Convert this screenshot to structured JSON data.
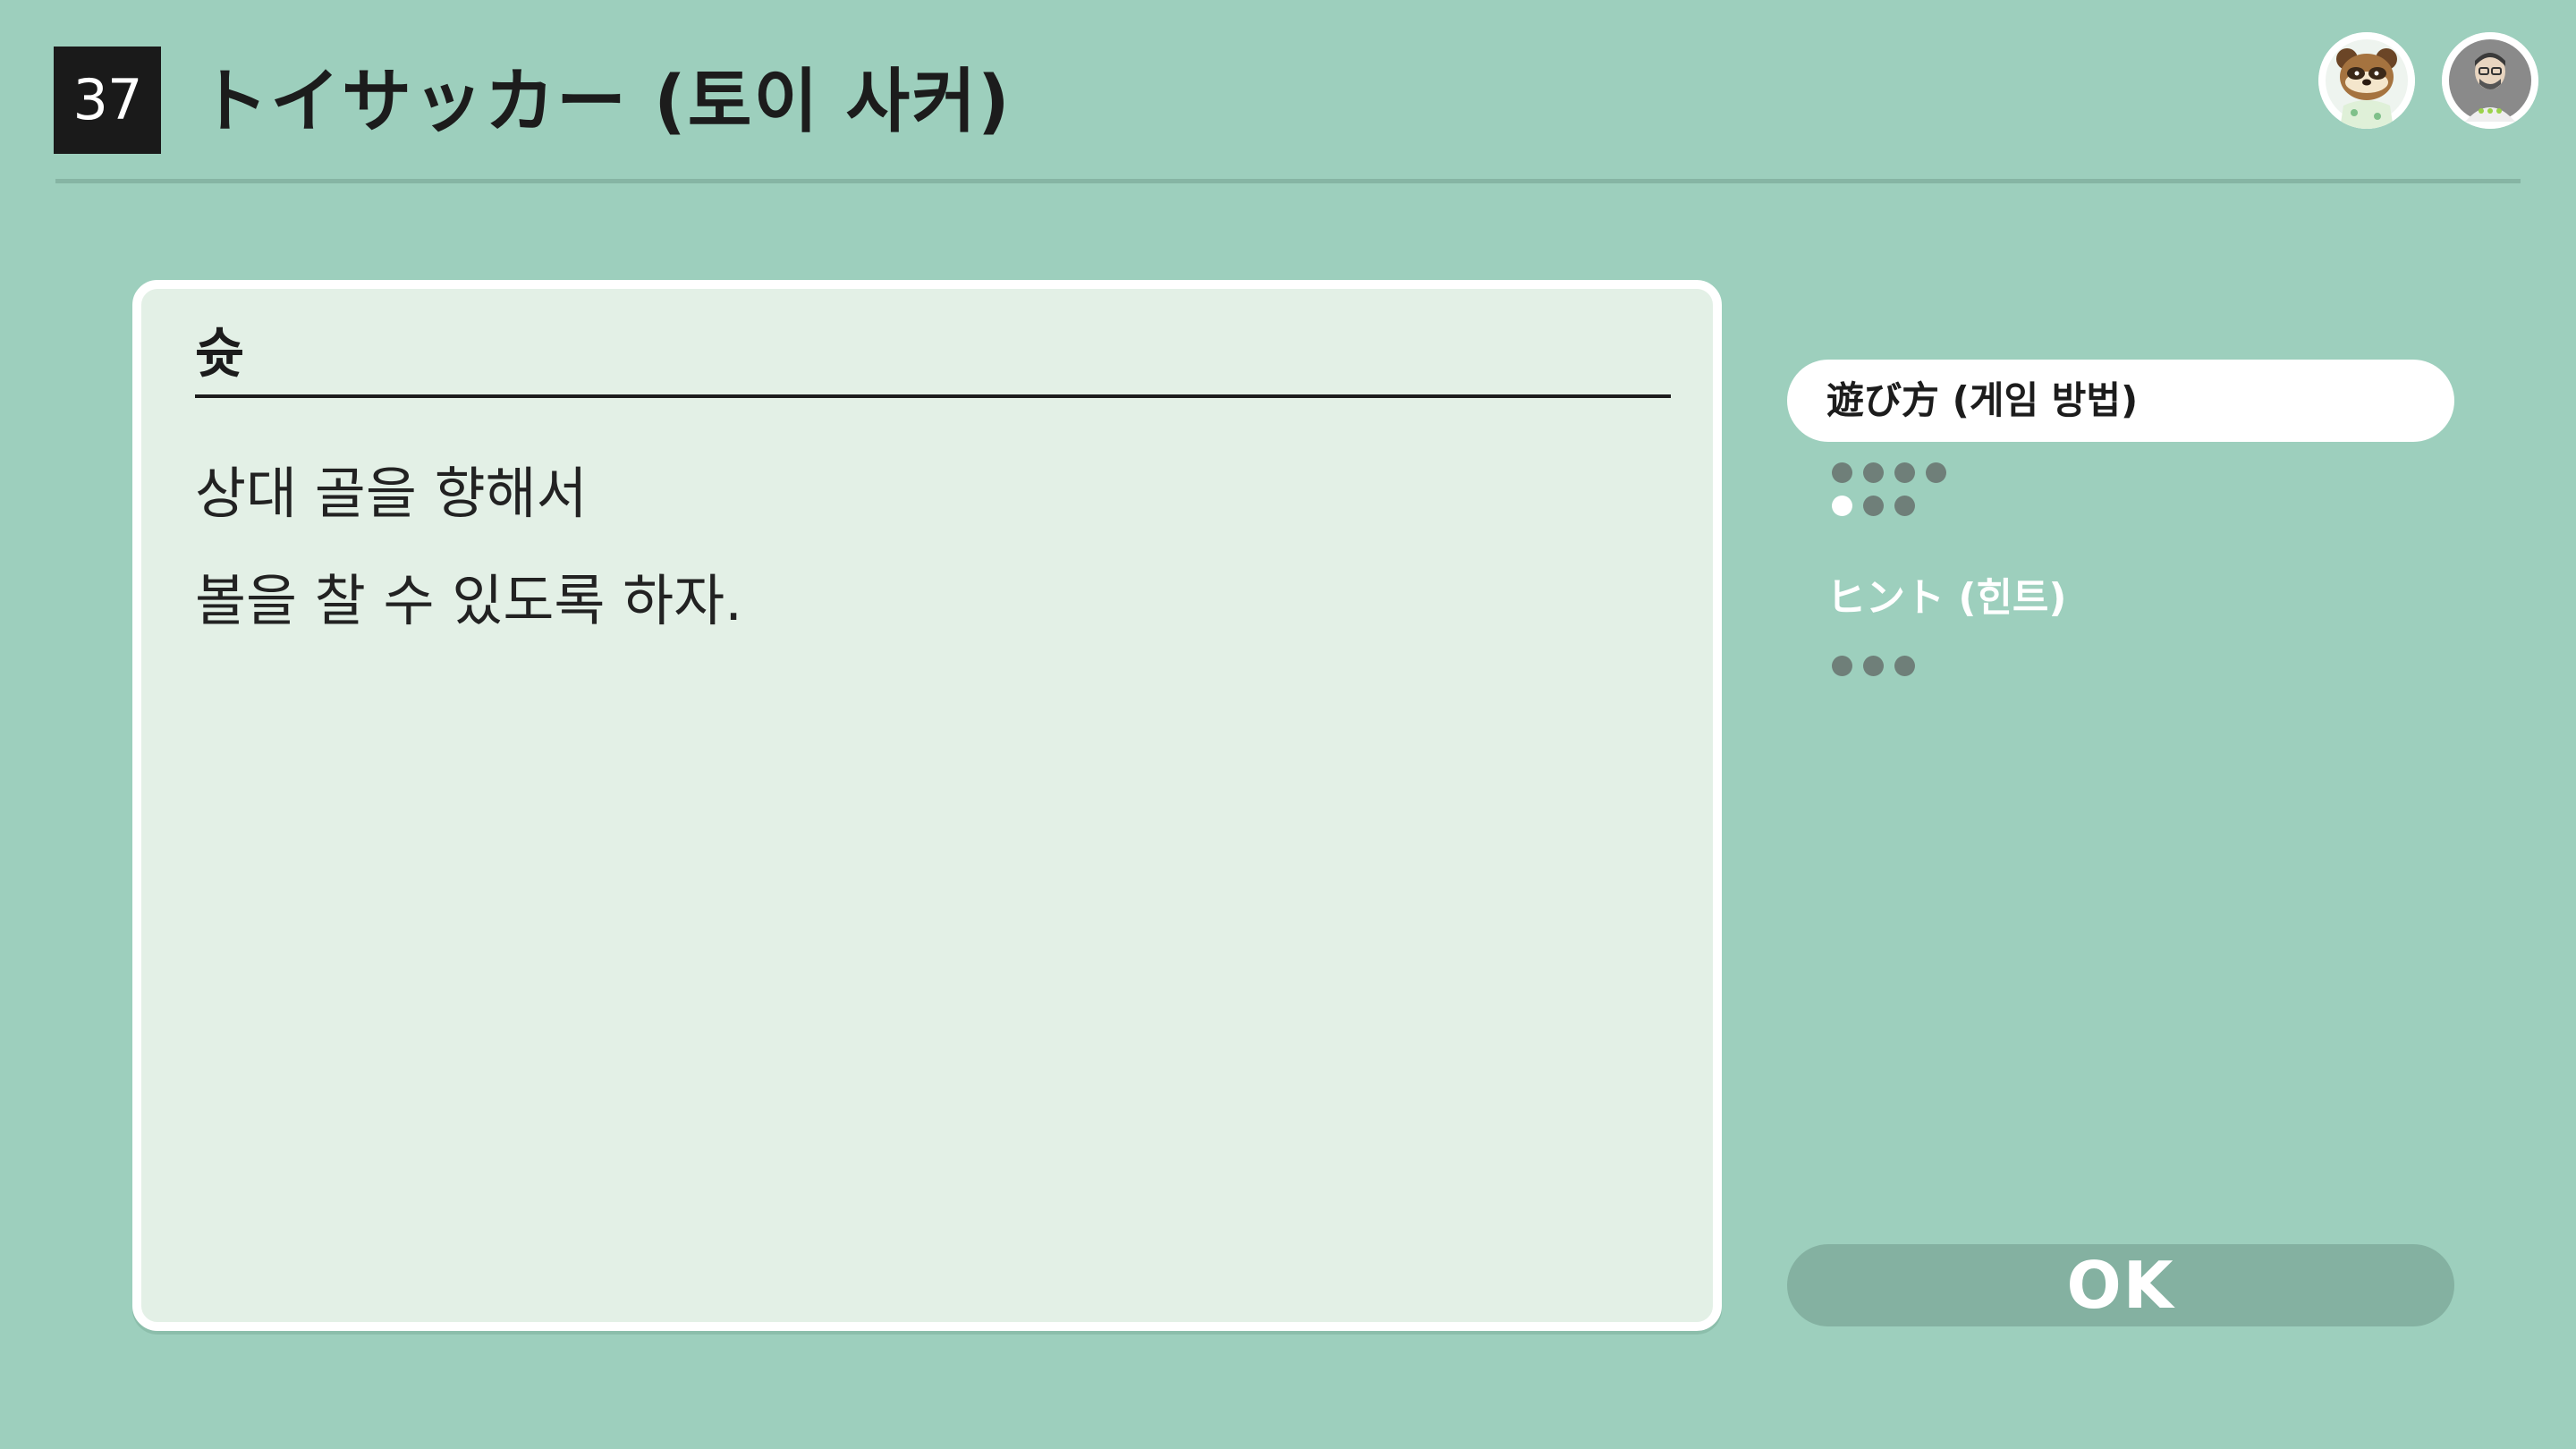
{
  "header": {
    "number": "37",
    "title": "トイサッカー (토이 사커)"
  },
  "avatars": [
    {
      "icon": "raccoon-character-icon"
    },
    {
      "icon": "user-profile-icon"
    }
  ],
  "panel": {
    "heading": "슛",
    "lines": [
      "상대 골을 향해서",
      "볼을 찰 수 있도록 하자."
    ]
  },
  "menu": {
    "howto_label": "遊び方 (게임 방법)",
    "howto_pages_total": 7,
    "howto_page_current": 5,
    "hint_label": "ヒント (힌트)",
    "hint_pages_total": 3
  },
  "ok_button": {
    "label": "OK"
  },
  "colors": {
    "background": "#9dcfbd",
    "panel": "#e3f0e6",
    "ok_button": "#84b1a1",
    "dot_inactive": "#6f7f79",
    "dot_active": "#ffffff"
  }
}
